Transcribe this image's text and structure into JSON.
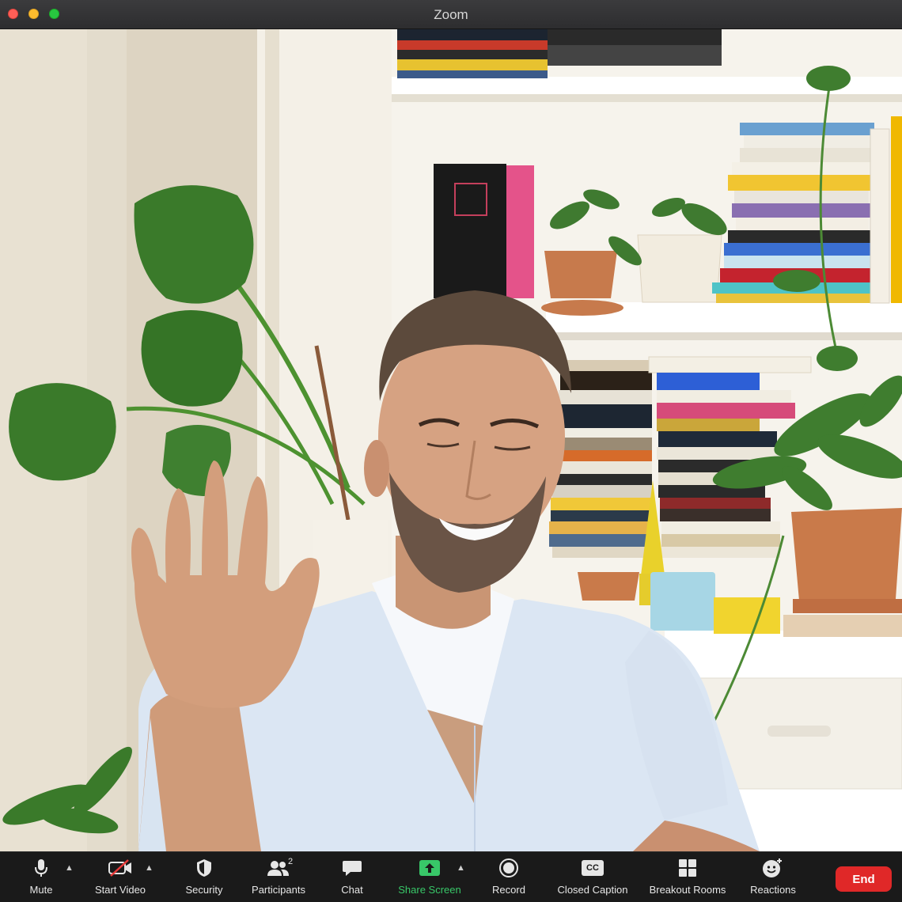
{
  "window": {
    "title": "Zoom"
  },
  "toolbar": {
    "mute": "Mute",
    "start_video": "Start Video",
    "security": "Security",
    "participants": "Participants",
    "participant_count": "2",
    "chat": "Chat",
    "share_screen": "Share Screen",
    "record": "Record",
    "closed_caption": "Closed Caption",
    "cc_badge": "CC",
    "breakout_rooms": "Breakout Rooms",
    "reactions": "Reactions",
    "end": "End"
  },
  "colors": {
    "share_green": "#38c768",
    "end_red": "#e02828",
    "toolbar_bg": "#1a1a1a"
  },
  "icons": [
    "microphone-icon",
    "video-off-icon",
    "shield-icon",
    "participants-icon",
    "chat-bubble-icon",
    "share-screen-icon",
    "record-icon",
    "closed-caption-icon",
    "breakout-rooms-icon",
    "reactions-icon",
    "caret-up-icon"
  ]
}
